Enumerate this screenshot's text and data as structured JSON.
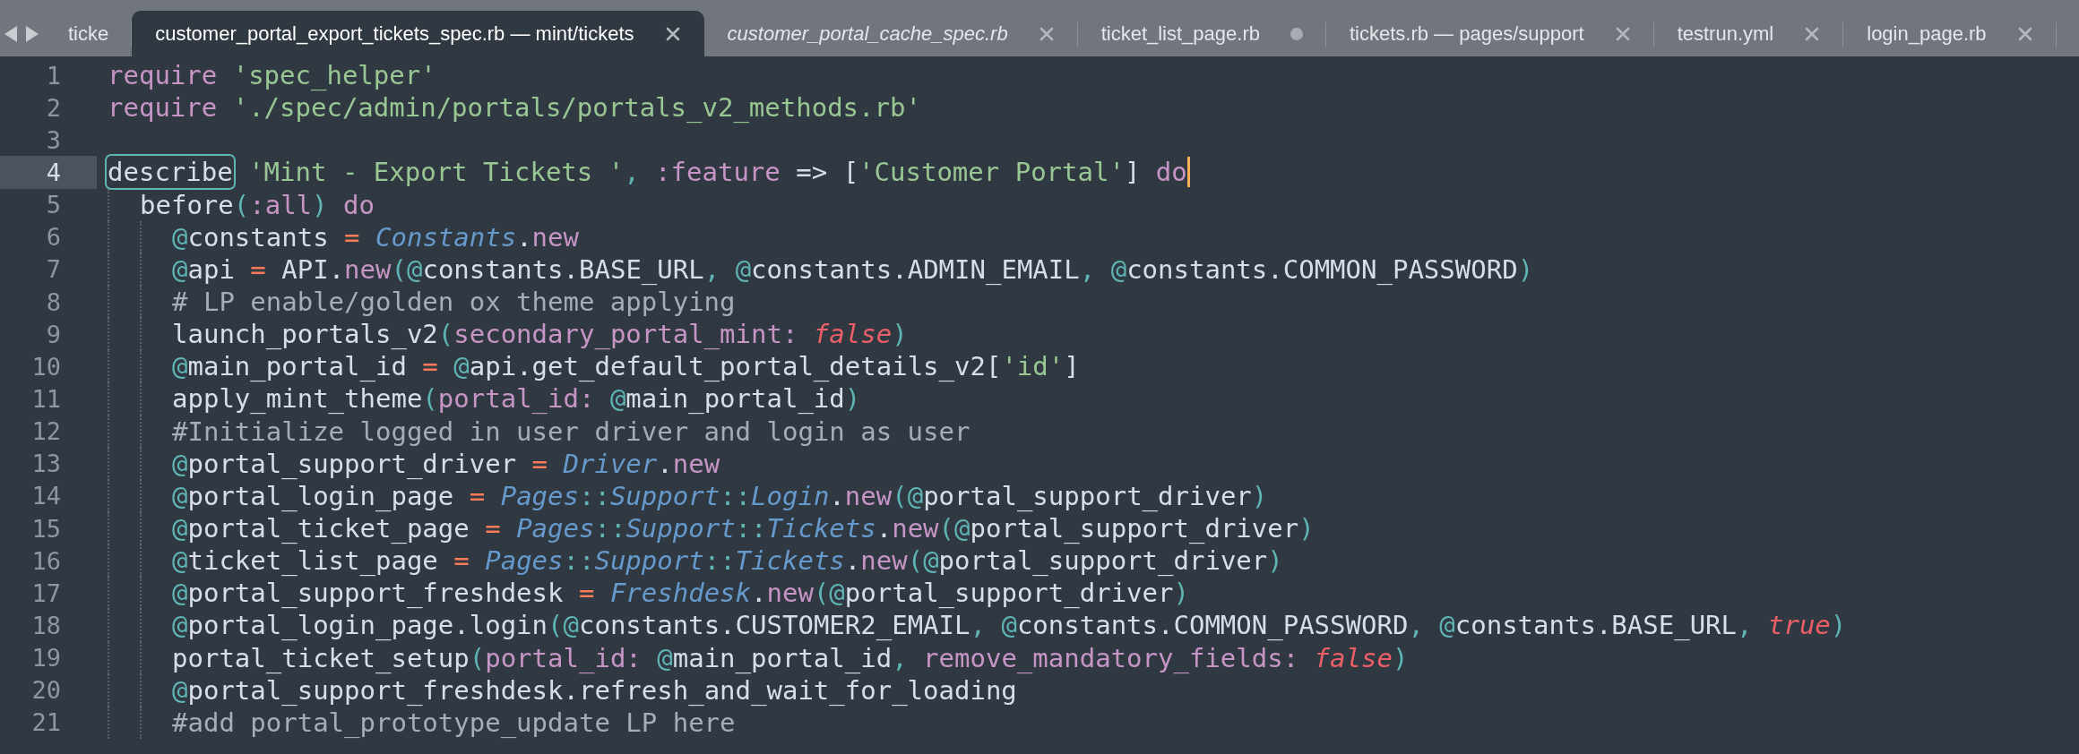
{
  "tabs": [
    {
      "label": "ticke",
      "selected": false,
      "preview": false
    },
    {
      "label": "customer_portal_export_tickets_spec.rb — mint/tickets",
      "selected": true,
      "preview": false,
      "closable": true,
      "modified": false
    },
    {
      "label": "customer_portal_cache_spec.rb",
      "selected": false,
      "preview": true,
      "closable": true,
      "modified": false
    },
    {
      "label": "ticket_list_page.rb",
      "selected": false,
      "preview": false,
      "modified": true
    },
    {
      "label": "tickets.rb — pages/support",
      "selected": false,
      "preview": false,
      "closable": true,
      "modified": false
    },
    {
      "label": "testrun.yml",
      "selected": false,
      "preview": false,
      "closable": true,
      "modified": false
    },
    {
      "label": "login_page.rb",
      "selected": false,
      "preview": false,
      "closable": true,
      "modified": false
    }
  ],
  "lines": [
    {
      "number": "1",
      "tokens": [
        {
          "kind": "kw",
          "text": "require "
        },
        {
          "kind": "str",
          "text": "'spec_helper'"
        }
      ]
    },
    {
      "number": "2",
      "tokens": [
        {
          "kind": "kw",
          "text": "require "
        },
        {
          "kind": "str",
          "text": "'./spec/admin/portals/portals_v2_methods.rb'"
        }
      ]
    },
    {
      "number": "3"
    },
    {
      "number": "4",
      "current": true,
      "cursor": true,
      "tokens": [
        {
          "kind": "matched",
          "text": "describe"
        },
        {
          "kind": "str",
          "text": " 'Mint - Export Tickets '"
        },
        {
          "kind": "punct",
          "text": ", "
        },
        {
          "kind": "kw",
          "text": ":feature"
        },
        {
          "kind": "plain",
          "text": " => ["
        },
        {
          "kind": "str",
          "text": "'Customer Portal'"
        },
        {
          "kind": "plain",
          "text": "] "
        },
        {
          "kind": "kw",
          "text": "do"
        }
      ],
      "children": [
        {
          "number": "5",
          "tokens": [
            {
              "kind": "plain",
              "text": "before"
            },
            {
              "kind": "punct",
              "text": "("
            },
            {
              "kind": "kw",
              "text": ":all"
            },
            {
              "kind": "punct",
              "text": ")"
            },
            {
              "kind": "kw",
              "text": " do"
            }
          ],
          "children": [
            {
              "number": "6",
              "tokens": [
                {
                  "kind": "ivar",
                  "text": "@constants"
                },
                {
                  "kind": "op",
                  "text": " = "
                },
                {
                  "kind": "cls",
                  "text": "Constants"
                },
                {
                  "kind": "plain",
                  "text": "."
                },
                {
                  "kind": "kw",
                  "text": "new"
                }
              ]
            },
            {
              "number": "7",
              "tokens": [
                {
                  "kind": "ivar",
                  "text": "@api"
                },
                {
                  "kind": "op",
                  "text": " = "
                },
                {
                  "kind": "plain",
                  "text": "API."
                },
                {
                  "kind": "kw",
                  "text": "new"
                },
                {
                  "kind": "punct",
                  "text": "("
                },
                {
                  "kind": "ivar",
                  "text": "@constants.BASE_URL"
                },
                {
                  "kind": "punct",
                  "text": ", "
                },
                {
                  "kind": "ivar",
                  "text": "@constants.ADMIN_EMAIL"
                },
                {
                  "kind": "punct",
                  "text": ", "
                },
                {
                  "kind": "ivar",
                  "text": "@constants.COMMON_PASSWORD"
                },
                {
                  "kind": "punct",
                  "text": ")"
                }
              ]
            },
            {
              "number": "8",
              "tokens": [
                {
                  "kind": "cmt",
                  "text": "# LP enable/golden ox theme applying"
                }
              ]
            },
            {
              "number": "9",
              "tokens": [
                {
                  "kind": "plain",
                  "text": "launch_portals_v2"
                },
                {
                  "kind": "punct",
                  "text": "("
                },
                {
                  "kind": "kw",
                  "text": "secondary_portal_mint: "
                },
                {
                  "kind": "bool",
                  "text": "false"
                },
                {
                  "kind": "punct",
                  "text": ")"
                }
              ]
            },
            {
              "number": "10",
              "tokens": [
                {
                  "kind": "ivar",
                  "text": "@main_portal_id"
                },
                {
                  "kind": "op",
                  "text": " = "
                },
                {
                  "kind": "ivar",
                  "text": "@api.get_default_portal_details_v2["
                },
                {
                  "kind": "str",
                  "text": "'id'"
                },
                {
                  "kind": "plain",
                  "text": "]"
                }
              ]
            },
            {
              "number": "11",
              "tokens": [
                {
                  "kind": "plain",
                  "text": "apply_mint_theme"
                },
                {
                  "kind": "punct",
                  "text": "("
                },
                {
                  "kind": "kw",
                  "text": "portal_id: "
                },
                {
                  "kind": "ivar",
                  "text": "@main_portal_id"
                },
                {
                  "kind": "punct",
                  "text": ")"
                }
              ]
            },
            {
              "number": "12",
              "tokens": [
                {
                  "kind": "cmt",
                  "text": "#Initialize logged in user driver and login as user"
                }
              ]
            },
            {
              "number": "13",
              "tokens": [
                {
                  "kind": "ivar",
                  "text": "@portal_support_driver"
                },
                {
                  "kind": "op",
                  "text": " = "
                },
                {
                  "kind": "cls",
                  "text": "Driver"
                },
                {
                  "kind": "plain",
                  "text": "."
                },
                {
                  "kind": "kw",
                  "text": "new"
                }
              ]
            },
            {
              "number": "14",
              "tokens": [
                {
                  "kind": "ivar",
                  "text": "@portal_login_page"
                },
                {
                  "kind": "op",
                  "text": " = "
                },
                {
                  "kind": "cls",
                  "text": "Pages"
                },
                {
                  "kind": "punct",
                  "text": "::"
                },
                {
                  "kind": "cls",
                  "text": "Support"
                },
                {
                  "kind": "punct",
                  "text": "::"
                },
                {
                  "kind": "cls",
                  "text": "Login"
                },
                {
                  "kind": "plain",
                  "text": "."
                },
                {
                  "kind": "kw",
                  "text": "new"
                },
                {
                  "kind": "punct",
                  "text": "("
                },
                {
                  "kind": "ivar",
                  "text": "@portal_support_driver"
                },
                {
                  "kind": "punct",
                  "text": ")"
                }
              ]
            },
            {
              "number": "15",
              "tokens": [
                {
                  "kind": "ivar",
                  "text": "@portal_ticket_page"
                },
                {
                  "kind": "op",
                  "text": " = "
                },
                {
                  "kind": "cls",
                  "text": "Pages"
                },
                {
                  "kind": "punct",
                  "text": "::"
                },
                {
                  "kind": "cls",
                  "text": "Support"
                },
                {
                  "kind": "punct",
                  "text": "::"
                },
                {
                  "kind": "cls",
                  "text": "Tickets"
                },
                {
                  "kind": "plain",
                  "text": "."
                },
                {
                  "kind": "kw",
                  "text": "new"
                },
                {
                  "kind": "punct",
                  "text": "("
                },
                {
                  "kind": "ivar",
                  "text": "@portal_support_driver"
                },
                {
                  "kind": "punct",
                  "text": ")"
                }
              ]
            },
            {
              "number": "16",
              "tokens": [
                {
                  "kind": "ivar",
                  "text": "@ticket_list_page"
                },
                {
                  "kind": "op",
                  "text": " = "
                },
                {
                  "kind": "cls",
                  "text": "Pages"
                },
                {
                  "kind": "punct",
                  "text": "::"
                },
                {
                  "kind": "cls",
                  "text": "Support"
                },
                {
                  "kind": "punct",
                  "text": "::"
                },
                {
                  "kind": "cls",
                  "text": "Tickets"
                },
                {
                  "kind": "plain",
                  "text": "."
                },
                {
                  "kind": "kw",
                  "text": "new"
                },
                {
                  "kind": "punct",
                  "text": "("
                },
                {
                  "kind": "ivar",
                  "text": "@portal_support_driver"
                },
                {
                  "kind": "punct",
                  "text": ")"
                }
              ]
            },
            {
              "number": "17",
              "tokens": [
                {
                  "kind": "ivar",
                  "text": "@portal_support_freshdesk"
                },
                {
                  "kind": "op",
                  "text": " = "
                },
                {
                  "kind": "cls",
                  "text": "Freshdesk"
                },
                {
                  "kind": "plain",
                  "text": "."
                },
                {
                  "kind": "kw",
                  "text": "new"
                },
                {
                  "kind": "punct",
                  "text": "("
                },
                {
                  "kind": "ivar",
                  "text": "@portal_support_driver"
                },
                {
                  "kind": "punct",
                  "text": ")"
                }
              ]
            },
            {
              "number": "18",
              "tokens": [
                {
                  "kind": "ivar",
                  "text": "@portal_login_page.login"
                },
                {
                  "kind": "punct",
                  "text": "("
                },
                {
                  "kind": "ivar",
                  "text": "@constants.CUSTOMER2_EMAIL"
                },
                {
                  "kind": "punct",
                  "text": ", "
                },
                {
                  "kind": "ivar",
                  "text": "@constants.COMMON_PASSWORD"
                },
                {
                  "kind": "punct",
                  "text": ", "
                },
                {
                  "kind": "ivar",
                  "text": "@constants.BASE_URL"
                },
                {
                  "kind": "punct",
                  "text": ", "
                },
                {
                  "kind": "bool",
                  "text": "true"
                },
                {
                  "kind": "punct",
                  "text": ")"
                }
              ]
            },
            {
              "number": "19",
              "tokens": [
                {
                  "kind": "plain",
                  "text": "portal_ticket_setup"
                },
                {
                  "kind": "punct",
                  "text": "("
                },
                {
                  "kind": "kw",
                  "text": "portal_id: "
                },
                {
                  "kind": "ivar",
                  "text": "@main_portal_id"
                },
                {
                  "kind": "punct",
                  "text": ", "
                },
                {
                  "kind": "kw",
                  "text": "remove_mandatory_fields: "
                },
                {
                  "kind": "bool",
                  "text": "false"
                },
                {
                  "kind": "punct",
                  "text": ")"
                }
              ]
            },
            {
              "number": "20",
              "tokens": [
                {
                  "kind": "ivar",
                  "text": "@portal_support_freshdesk.refresh_and_wait_for_loading"
                }
              ]
            },
            {
              "number": "21",
              "tokens": [
                {
                  "kind": "cmt",
                  "text": "#add portal_prototype_update LP here"
                }
              ]
            }
          ]
        }
      ]
    }
  ]
}
